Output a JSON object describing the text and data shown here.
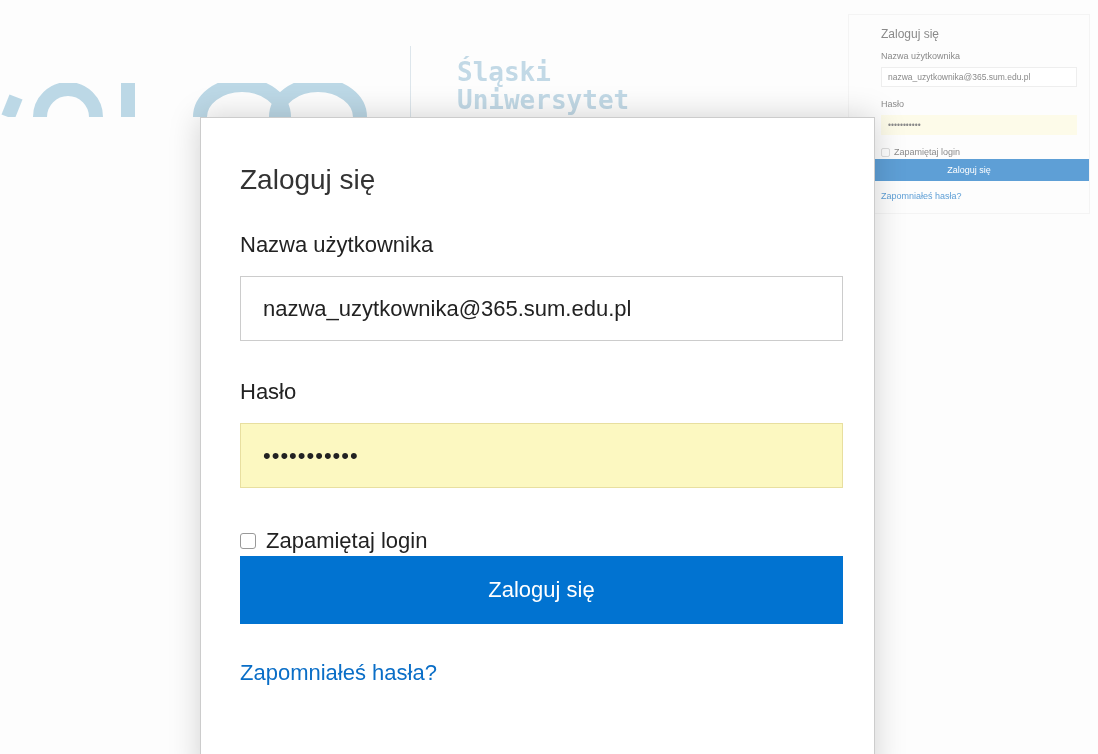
{
  "background_page": {
    "logo_text": [
      "Śląski",
      "Uniwersytet"
    ],
    "login_panel": {
      "title": "Zaloguj się",
      "username_label": "Nazwa użytkownika",
      "username_value": "nazwa_uzytkownika@365.sum.edu.pl",
      "password_label": "Hasło",
      "password_value": "•••••••••••",
      "remember": {
        "label": "Zapamiętaj login",
        "checked": false
      },
      "submit": "Zaloguj się",
      "forgot_link": "Zapomniałeś hasła?"
    }
  },
  "dialog": {
    "title": "Zaloguj się",
    "username_label": "Nazwa użytkownika",
    "username_value": "nazwa_uzytkownika@365.sum.edu.pl",
    "password_label": "Hasło",
    "password_value": "•••••••••••",
    "password_autofilled": true,
    "remember": {
      "label": "Zapamiętaj login",
      "checked": false
    },
    "submit": "Zaloguj się",
    "forgot_link": "Zapomniałeś hasła?"
  }
}
